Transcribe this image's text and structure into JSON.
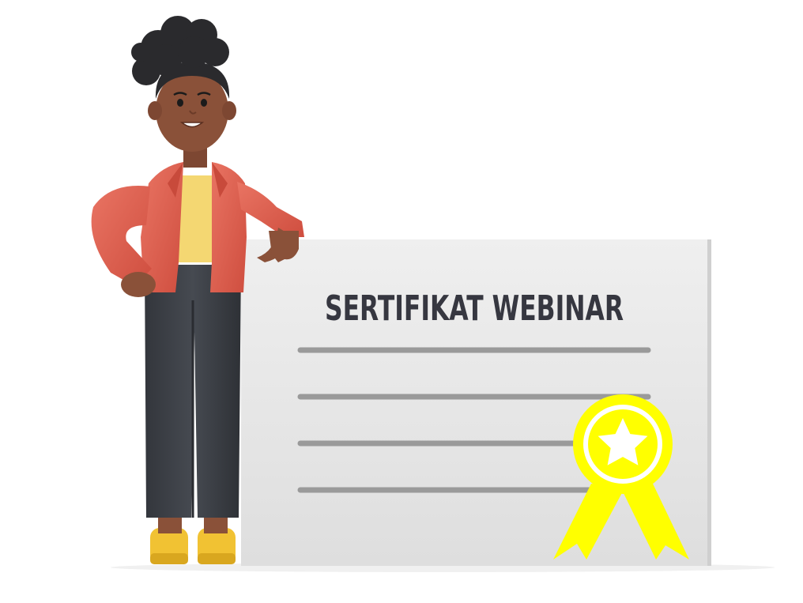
{
  "certificate": {
    "title": "SERTIFIKAT WEBINAR",
    "line_count": 4
  },
  "icons": {
    "badge": "award-ribbon-icon",
    "star": "star-icon",
    "person": "woman-character-illustration"
  },
  "colors": {
    "background": "#ffffff",
    "certificate_paper": "#e6e6e6",
    "certificate_lines": "#9a9a9a",
    "title_text": "#363740",
    "badge_yellow": "#ffff00",
    "jacket": "#e2604f",
    "top": "#f4d772",
    "trousers": "#3c3f45",
    "shoes": "#f1c233",
    "skin": "#8a5139",
    "hair": "#2a2a2d"
  }
}
